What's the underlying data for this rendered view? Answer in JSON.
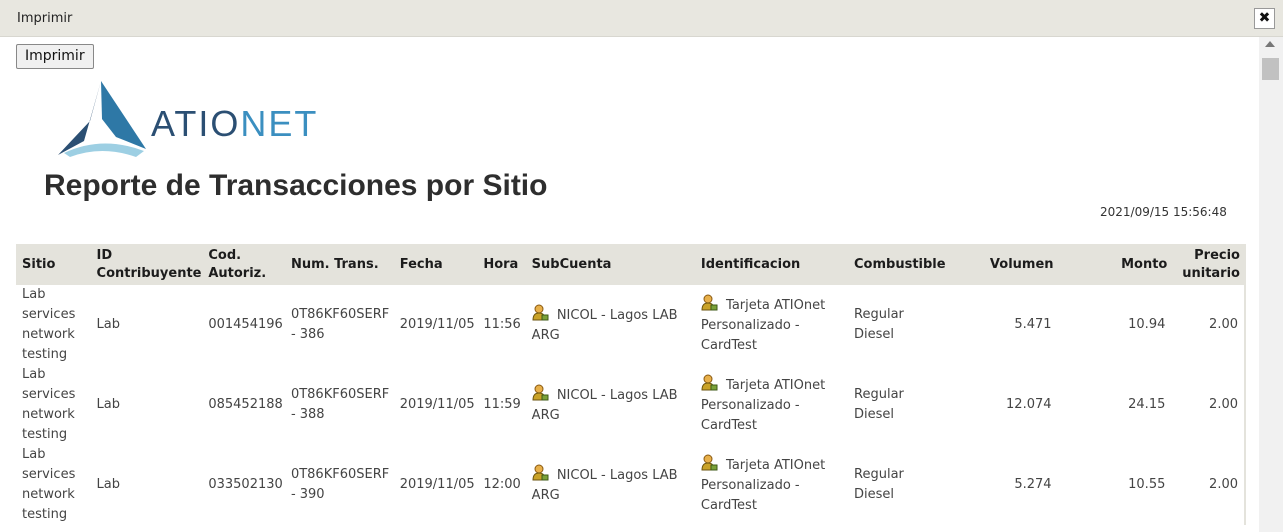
{
  "window": {
    "title": "Imprimir",
    "close_symbol": "✖"
  },
  "toolbar": {
    "print_label": "Imprimir"
  },
  "logo": {
    "text_part1": "ATIO",
    "text_part2": "NET"
  },
  "report": {
    "title": "Reporte de Transacciones por Sitio",
    "date": "2021/09/15 15:56:48"
  },
  "columns": {
    "sitio": "Sitio",
    "id_contribuyente_1": "ID",
    "id_contribuyente_2": "Contribuyente",
    "cod_autoriz_1": "Cod.",
    "cod_autoriz_2": "Autoriz.",
    "num_trans": "Num. Trans.",
    "fecha": "Fecha",
    "hora": "Hora",
    "subcuenta": "SubCuenta",
    "identificacion": "Identificacion",
    "combustible": "Combustible",
    "volumen": "Volumen",
    "monto": "Monto",
    "precio_1": "Precio",
    "precio_2": "unitario"
  },
  "rows": [
    {
      "sitio": [
        "Lab",
        "services",
        "network",
        "testing"
      ],
      "id_contribuyente": "Lab",
      "cod_autoriz": "001454196",
      "num_trans": [
        "0T86KF60SERF",
        "- 386"
      ],
      "fecha": "2019/11/05",
      "hora": "11:56",
      "subcuenta": [
        "NICOL - Lagos LAB",
        "ARG"
      ],
      "identificacion": [
        "Tarjeta ATIOnet",
        "Personalizado -",
        "CardTest"
      ],
      "combustible": [
        "Regular",
        "Diesel"
      ],
      "volumen": "5.471",
      "monto": "10.94",
      "precio_unitario": "2.00"
    },
    {
      "sitio": [
        "Lab",
        "services",
        "network",
        "testing"
      ],
      "id_contribuyente": "Lab",
      "cod_autoriz": "085452188",
      "num_trans": [
        "0T86KF60SERF",
        "- 388"
      ],
      "fecha": "2019/11/05",
      "hora": "11:59",
      "subcuenta": [
        "NICOL - Lagos LAB",
        "ARG"
      ],
      "identificacion": [
        "Tarjeta ATIOnet",
        "Personalizado -",
        "CardTest"
      ],
      "combustible": [
        "Regular",
        "Diesel"
      ],
      "volumen": "12.074",
      "monto": "24.15",
      "precio_unitario": "2.00"
    },
    {
      "sitio": [
        "Lab",
        "services",
        "network",
        "testing"
      ],
      "id_contribuyente": "Lab",
      "cod_autoriz": "033502130",
      "num_trans": [
        "0T86KF60SERF",
        "- 390"
      ],
      "fecha": "2019/11/05",
      "hora": "12:00",
      "subcuenta": [
        "NICOL - Lagos LAB",
        "ARG"
      ],
      "identificacion": [
        "Tarjeta ATIOnet",
        "Personalizado -",
        "CardTest"
      ],
      "combustible": [
        "Regular",
        "Diesel"
      ],
      "volumen": "5.274",
      "monto": "10.55",
      "precio_unitario": "2.00"
    }
  ],
  "icons": {
    "close": "close-icon",
    "user": "user-icon",
    "scroll_up": "scroll-up-arrow-icon"
  },
  "colors": {
    "header_bg": "#e4e3dc",
    "titlebar_bg": "#e8e7e0",
    "logo_dark": "#2b4f73",
    "logo_light": "#3b8fc0"
  }
}
